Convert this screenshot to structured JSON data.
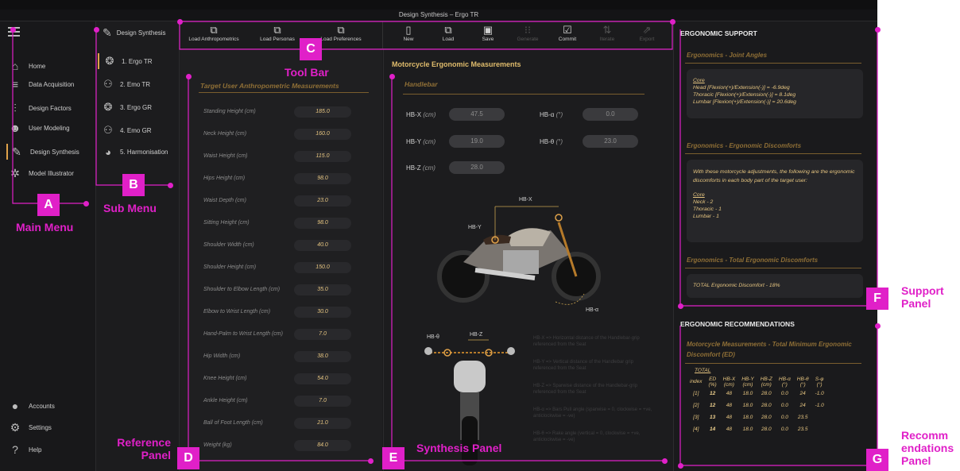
{
  "window": {
    "title": "Design Synthesis  –  Ergo TR"
  },
  "main_menu": {
    "items": [
      {
        "icon": "home-icon",
        "glyph": "⌂",
        "label": "Home"
      },
      {
        "icon": "database-icon",
        "glyph": "≡",
        "label": "Data Acquisition"
      },
      {
        "icon": "sliders-icon",
        "glyph": "⫶",
        "label": "Design Factors"
      },
      {
        "icon": "user-gear-icon",
        "glyph": "☻",
        "label": "User Modeling"
      },
      {
        "icon": "edit-icon",
        "glyph": "✎",
        "label": "Design Synthesis"
      },
      {
        "icon": "aperture-icon",
        "glyph": "✲",
        "label": "Model Illustrator"
      }
    ],
    "bottom_items": [
      {
        "icon": "account-icon",
        "glyph": "●",
        "label": "Accounts"
      },
      {
        "icon": "settings-icon",
        "glyph": "⚙",
        "label": "Settings"
      },
      {
        "icon": "help-icon",
        "glyph": "?",
        "label": "Help"
      }
    ]
  },
  "sub_menu": {
    "header": "Design Synthesis",
    "items": [
      {
        "icon": "ergo-icon",
        "glyph": "❂",
        "label": "1. Ergo TR"
      },
      {
        "icon": "emo-icon",
        "glyph": "⚇",
        "label": "2. Emo TR"
      },
      {
        "icon": "ergo-icon",
        "glyph": "❂",
        "label": "3. Ergo GR"
      },
      {
        "icon": "emo-icon",
        "glyph": "⚇",
        "label": "4. Emo GR"
      },
      {
        "icon": "harmonise-icon",
        "glyph": "◕",
        "label": "5. Harmonisation"
      }
    ]
  },
  "toolbar": {
    "left": [
      {
        "glyph": "⧉",
        "label": "Load Anthropometrics"
      },
      {
        "glyph": "⧉",
        "label": "Load Personas"
      },
      {
        "glyph": "⧉",
        "label": "Load Preferences"
      }
    ],
    "right": [
      {
        "glyph": "▯",
        "label": "New",
        "enabled": true
      },
      {
        "glyph": "⧉",
        "label": "Load",
        "enabled": true
      },
      {
        "glyph": "▣",
        "label": "Save",
        "enabled": true
      },
      {
        "glyph": "⁝⁝",
        "label": "Generate",
        "enabled": false
      },
      {
        "glyph": "☑",
        "label": "Commit",
        "enabled": true
      },
      {
        "glyph": "⇅",
        "label": "Iterate",
        "enabled": false
      },
      {
        "glyph": "⇗",
        "label": "Export",
        "enabled": false
      }
    ]
  },
  "reference_panel": {
    "title": "Target User Anthropometric Measurements",
    "measurements": [
      {
        "label": "Standing Height (cm)",
        "value": "185.0"
      },
      {
        "label": "Neck Height (cm)",
        "value": "160.0"
      },
      {
        "label": "Waist Height (cm)",
        "value": "115.0"
      },
      {
        "label": "Hips Height (cm)",
        "value": "98.0"
      },
      {
        "label": "Waist Depth (cm)",
        "value": "23.0"
      },
      {
        "label": "Sitting Height (cm)",
        "value": "98.0"
      },
      {
        "label": "Shoulder Width (cm)",
        "value": "40.0"
      },
      {
        "label": "Shoulder Height (cm)",
        "value": "150.0"
      },
      {
        "label": "Shoulder to Elbow Length (cm)",
        "value": "35.0"
      },
      {
        "label": "Elbow to Wrist Length (cm)",
        "value": "30.0"
      },
      {
        "label": "Hand-Palm to Wrist Length (cm)",
        "value": "7.0"
      },
      {
        "label": "Hip Width (cm)",
        "value": "38.0"
      },
      {
        "label": "Knee Height (cm)",
        "value": "54.0"
      },
      {
        "label": "Ankle Height (cm)",
        "value": "7.0"
      },
      {
        "label": "Ball of Foot Length (cm)",
        "value": "21.0"
      },
      {
        "label": "Weight (kg)",
        "value": "84.0"
      }
    ]
  },
  "synthesis_panel": {
    "title": "Motorcycle Ergonomic Measurements",
    "section": "Handlebar",
    "fields": [
      {
        "label": "HB-X",
        "unit": "(cm)",
        "value": "47.5"
      },
      {
        "label": "HB-α",
        "unit": "(°)",
        "value": "0.0"
      },
      {
        "label": "HB-Y",
        "unit": "(cm)",
        "value": "19.0"
      },
      {
        "label": "HB-θ",
        "unit": "(°)",
        "value": "23.0"
      },
      {
        "label": "HB-Z",
        "unit": "(cm)",
        "value": "28.0"
      }
    ],
    "diagram_labels": {
      "hbx": "HB-X",
      "hby": "HB-Y",
      "hba": "HB-α",
      "hbz": "HB-Z",
      "hbt": "HB-θ"
    },
    "legend": [
      "HB-X => Horizontal distance of the Handlebar-grip referenced from the Seat",
      "HB-Y => Vertical distance of the Handlebar grip referenced from the Seat",
      "HB-Z => Sparwise distance of the Handlebar-grip referenced from the Seat",
      "HB-α => Bars Pull angle (sparwise = 0, clockwise = +ve, anticlockwise = -ve)",
      "HB-θ => Rake angle (vertical = 0, clockwise = +ve, anticlockwise = -ve)"
    ]
  },
  "support_panel": {
    "header": "ERGONOMIC SUPPORT",
    "joint_angles": {
      "title": "Ergonomics - Joint Angles",
      "core": "Core",
      "lines": [
        "Head [Flexion(+)/Extension(-)]  =  -6.9deg",
        "Thoracic [Flexion(+)/Extension(-)]  =  8.1deg",
        "Lumbar [Flexion(+)/Extension(-)]  =  20.6deg"
      ]
    },
    "discomforts": {
      "title": "Ergonomics - Ergonomic Discomforts",
      "intro": "With these motorcycle adjustments, the following are the ergonomic discomforts in each body part of the target user:",
      "core": "Core",
      "lines": [
        "Neck  -  2",
        "Thoracic  -  1",
        "Lumbar  -  1"
      ]
    },
    "total": {
      "title": "Ergonomics - Total Ergonomic Discomforts",
      "line": "TOTAL Ergonomic Discomfort  -  18%"
    }
  },
  "recommendations_panel": {
    "header": "ERGONOMIC RECOMMENDATIONS",
    "title": "Motorcycle Measurements - Total Minimum Ergonomic Discomfort (ED)",
    "table_label": "TOTAL",
    "columns": [
      {
        "name": "index",
        "unit": ""
      },
      {
        "name": "ED",
        "unit": "(%)"
      },
      {
        "name": "HB-X",
        "unit": "(cm)"
      },
      {
        "name": "HB-Y",
        "unit": "(cm)"
      },
      {
        "name": "HB-Z",
        "unit": "(cm)"
      },
      {
        "name": "HB-α",
        "unit": "(°)"
      },
      {
        "name": "HB-θ",
        "unit": "(°)"
      },
      {
        "name": "S-φ",
        "unit": "(°)"
      }
    ],
    "rows": [
      [
        "[1]",
        "12",
        "48",
        "18.0",
        "28.0",
        "0.0",
        "24",
        "-1.0"
      ],
      [
        "[2]",
        "12",
        "48",
        "18.0",
        "28.0",
        "0.0",
        "24",
        "-1.0"
      ],
      [
        "[3]",
        "13",
        "48",
        "18.0",
        "28.0",
        "0.0",
        "23.5",
        ""
      ],
      [
        "[4]",
        "14",
        "48",
        "18.0",
        "28.0",
        "0.0",
        "23.5",
        ""
      ]
    ]
  },
  "annotations": {
    "A": {
      "badge": "A",
      "label": "Main Menu"
    },
    "B": {
      "badge": "B",
      "label": "Sub Menu"
    },
    "C": {
      "badge": "C",
      "label": "Tool Bar"
    },
    "D": {
      "badge": "D",
      "label_line1": "Reference",
      "label_line2": "Panel"
    },
    "E": {
      "badge": "E",
      "label": "Synthesis Panel"
    },
    "F": {
      "badge": "F",
      "label_line1": "Support",
      "label_line2": "Panel"
    },
    "G": {
      "badge": "G",
      "label_line1": "Recomm",
      "label_line2": "endations",
      "label_line3": "Panel"
    }
  },
  "colors": {
    "accent": "#e0a24a",
    "annotation": "#e020c8",
    "value_gold": "#e6c580"
  }
}
